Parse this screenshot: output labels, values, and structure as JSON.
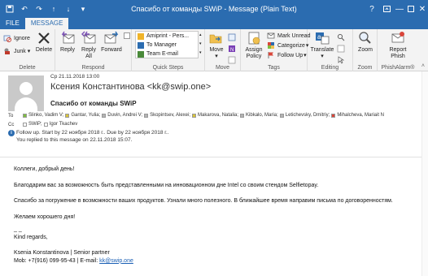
{
  "window": {
    "title": "Спасибо от команды SWiP - Message (Plain Text)",
    "help": "?",
    "controls": [
      "restore",
      "minimize",
      "maximize",
      "close"
    ]
  },
  "tabs": [
    {
      "label": "FILE",
      "active": false
    },
    {
      "label": "MESSAGE",
      "active": true
    }
  ],
  "ribbon": {
    "delete_group": {
      "label": "Delete",
      "ignore": "Ignore",
      "junk": "Junk",
      "delete": "Delete"
    },
    "respond_group": {
      "label": "Respond",
      "reply": "Reply",
      "reply_all": "Reply All",
      "forward": "Forward"
    },
    "quick_steps": {
      "label": "Quick Steps",
      "items": [
        "Amiprint - Pers...",
        "To Manager",
        "Team E-mail"
      ]
    },
    "move_group": {
      "label": "Move",
      "move": "Move"
    },
    "tags_group": {
      "label": "Tags",
      "assign_policy": "Assign Policy",
      "mark_unread": "Mark Unread",
      "categorize": "Categorize",
      "follow_up": "Follow Up"
    },
    "editing_group": {
      "label": "Editing",
      "translate": "Translate"
    },
    "zoom_group": {
      "label": "Zoom",
      "zoom": "Zoom"
    },
    "phish_group": {
      "label": "PhishAlarm®",
      "report": "Report Phish"
    }
  },
  "message": {
    "sent": "Ср 21.11.2018 13:00",
    "sender": "Ксения Константинова <kk@swip.one>",
    "subject": "Спасибо от команды SWiP",
    "to_label": "To",
    "to": [
      {
        "name": "Slinko, Vadim V;",
        "color": "#7fbf3f"
      },
      {
        "name": "Gantar, Yulia;",
        "color": "#d9c43a"
      },
      {
        "name": "Duvin, Andrei V;",
        "color": "#b3b3b3"
      },
      {
        "name": "Skopintsev, Alexei;",
        "color": "#b3b3b3"
      },
      {
        "name": "Makarova, Natalia;",
        "color": "#d9c43a"
      },
      {
        "name": "Kibkalo, Maria;",
        "color": "#b3b3b3"
      },
      {
        "name": "Letichevsky, Dmitriy;",
        "color": "#b3b3b3"
      },
      {
        "name": "Mihalcheva, Mariait N",
        "color": "#d9463a"
      }
    ],
    "cc_label": "Cc",
    "cc": [
      {
        "name": "SWiP;",
        "color": "#ffffff"
      },
      {
        "name": "Igor Tkachev",
        "color": "#ffffff"
      }
    ],
    "follow_up": "Follow up.  Start by 22 ноября 2018 г..  Due by 22 ноября 2018 г..",
    "replied": "You replied to this message on 22.11.2018 15:07.",
    "body": {
      "p1": "Коллеги, добрый день!",
      "p2": "Благодарим вас за возможность быть представленными на инновационном дне Intel со своим стендом Selfietopay.",
      "p3": "Спасибо за погружение в возможности ваших продуктов. Узнали много полезного. В ближайшее время направим письма по договоренностям.",
      "p4": "Желаем хорошего дня!",
      "sep": "_ _",
      "regards": "Kind regards,",
      "signature": "Ksenia Konstantinova | Senior partner",
      "mob_prefix": "Mob: +7(916) 099-95-43 | E-mail: ",
      "email": "kk@swip.one"
    }
  }
}
